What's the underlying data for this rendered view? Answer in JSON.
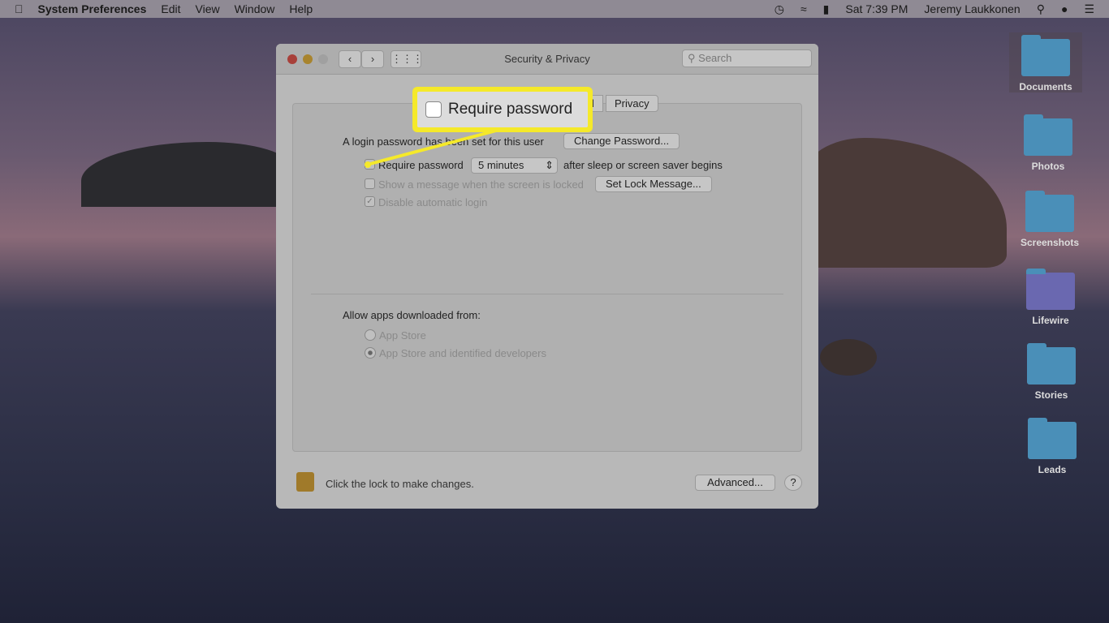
{
  "menubar": {
    "app": "System Preferences",
    "items": [
      "Edit",
      "View",
      "Window",
      "Help"
    ],
    "clock": "Sat 7:39 PM",
    "user": "Jeremy Laukkonen"
  },
  "window": {
    "title": "Security & Privacy",
    "search_placeholder": "Search",
    "tabs": [
      "ll",
      "Privacy"
    ],
    "login_text": "A login password has been set for this user",
    "change_password": "Change Password...",
    "require_password": "Require password",
    "delay": "5 minutes",
    "after_text": "after sleep or screen saver begins",
    "show_message": "Show a message when the screen is locked",
    "set_lock_message": "Set Lock Message...",
    "disable_login": "Disable automatic login",
    "allow_apps": "Allow apps downloaded from:",
    "opt_app_store": "App Store",
    "opt_identified": "App Store and identified developers",
    "lock_text": "Click the lock to make changes.",
    "advanced": "Advanced...",
    "help": "?"
  },
  "callout": {
    "label": "Require password",
    "color": "#f5e92a"
  },
  "desktop": [
    "Documents",
    "Photos",
    "Screenshots",
    "Lifewire",
    "Stories",
    "Leads"
  ]
}
